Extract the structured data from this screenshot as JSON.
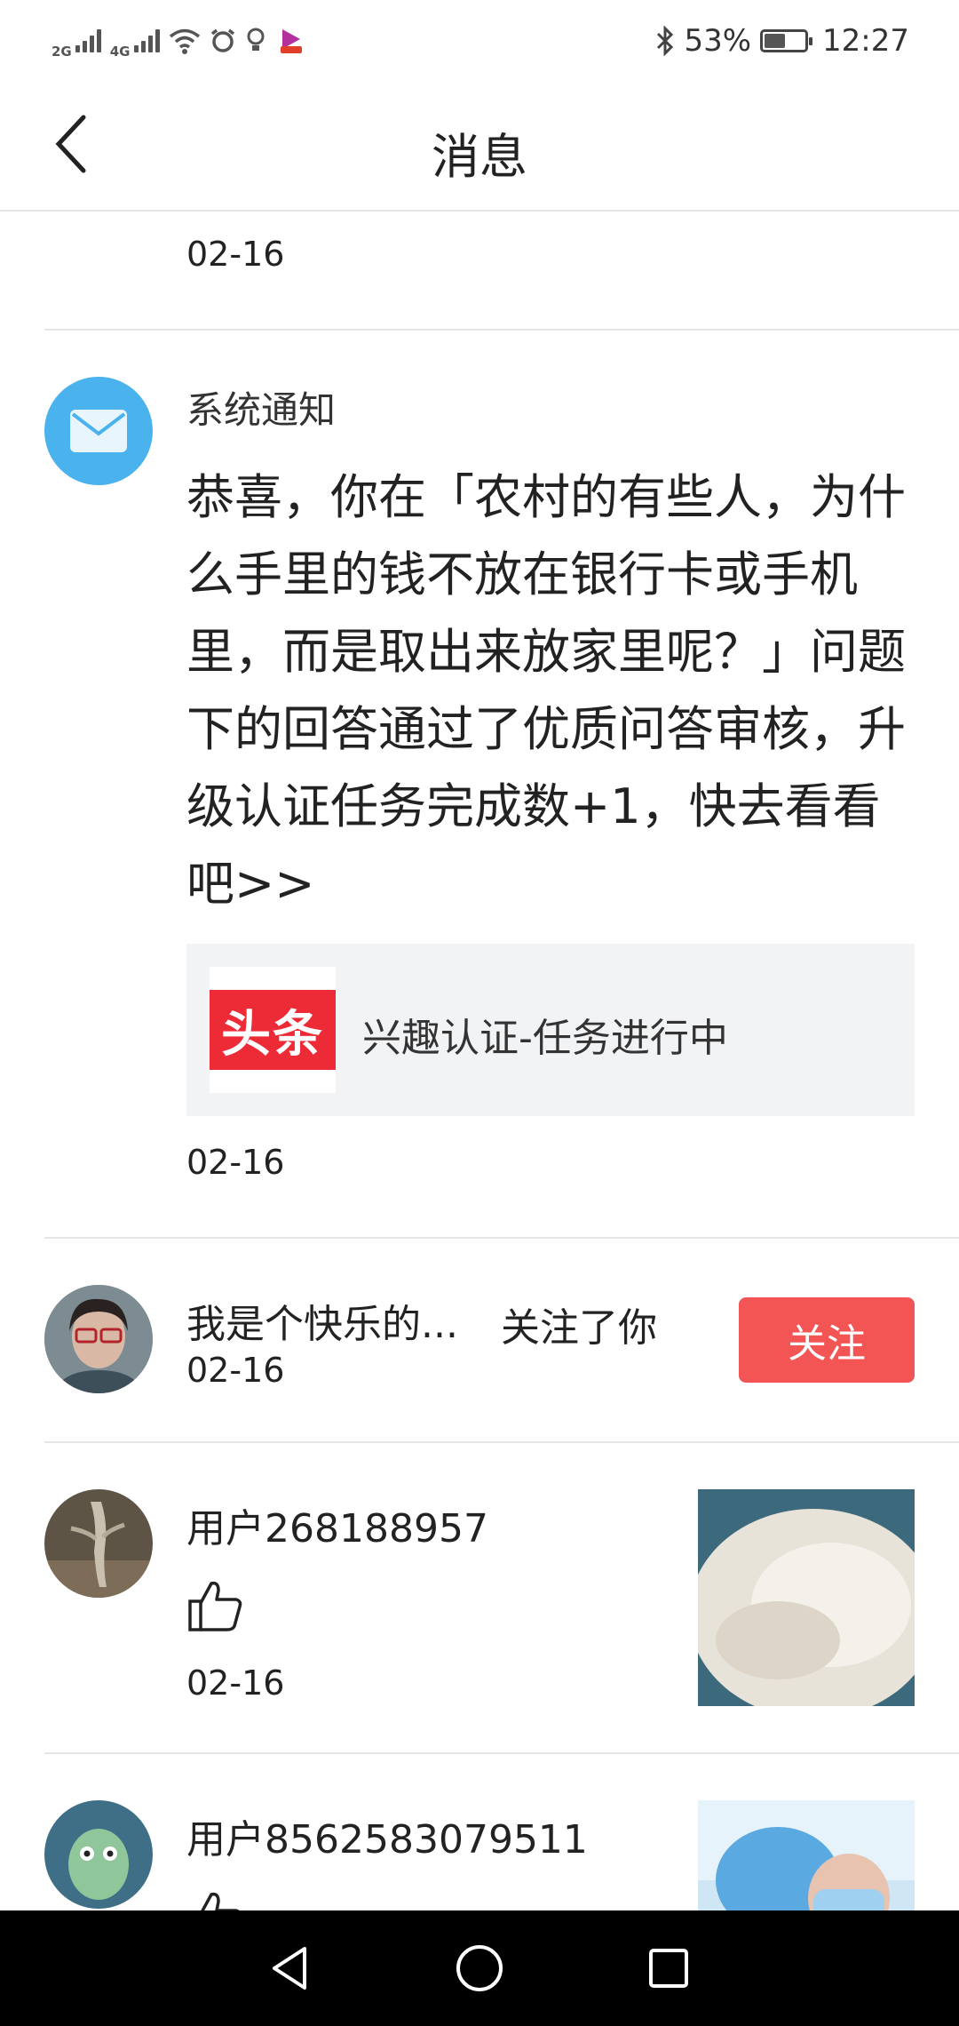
{
  "status_bar": {
    "network_1": "2G",
    "network_2": "4G",
    "battery_percent": "53%",
    "battery_level": 0.53,
    "time": "12:27"
  },
  "header": {
    "title": "消息"
  },
  "messages": [
    {
      "date": "02-16"
    },
    {
      "type": "system",
      "title": "系统通知",
      "body": "恭喜，你在「农村的有些人，为什么手里的钱不放在银行卡或手机里，而是取出来放家里呢？」问题下的回答通过了优质问答审核，升级认证任务完成数+1，快去看看吧>>",
      "card_logo": "头条",
      "card_text": "兴趣认证-任务进行中",
      "date": "02-16"
    },
    {
      "type": "follow",
      "name": "我是个快乐的...",
      "action": "关注了你",
      "date": "02-16",
      "button_label": "关注"
    },
    {
      "type": "like",
      "name": "用户268188957",
      "date": "02-16"
    },
    {
      "type": "like",
      "name": "用户8562583079511"
    }
  ],
  "colors": {
    "accent_red": "#f35454",
    "mail_blue": "#4ab2ec",
    "toutiao_red": "#ed2b36"
  }
}
